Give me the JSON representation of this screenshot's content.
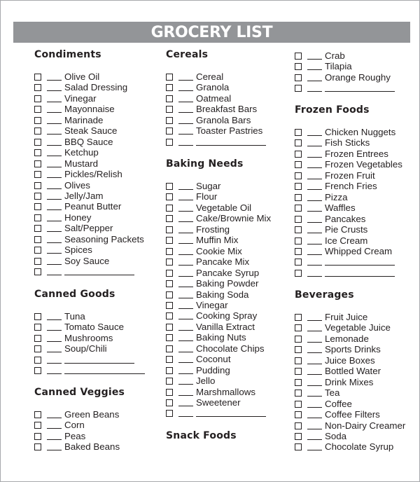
{
  "title": "GROCERY LIST",
  "colors": {
    "banner": "#939598",
    "text": "#231f20",
    "border": "#a7a9ac"
  },
  "columns": [
    {
      "sections": [
        {
          "heading": "Condiments",
          "items": [
            "Olive Oil",
            "Salad Dressing",
            "Vinegar",
            "Mayonnaise",
            "Marinade",
            "Steak Sauce",
            "BBQ Sauce",
            "Ketchup",
            "Mustard",
            "Pickles/Relish",
            "Olives",
            "Jelly/Jam",
            "Peanut Butter",
            "Honey",
            "Salt/Pepper",
            "Seasoning Packets",
            "Spices",
            "Soy Sauce",
            ""
          ]
        },
        {
          "heading": "Canned Goods",
          "items": [
            "Tuna",
            "Tomato Sauce",
            "Mushrooms",
            "Soup/Chili",
            "",
            ""
          ]
        },
        {
          "heading": "Canned Veggies",
          "items": [
            "Green Beans",
            "Corn",
            "Peas",
            "Baked Beans"
          ]
        }
      ]
    },
    {
      "sections": [
        {
          "heading": "Cereals",
          "items": [
            "Cereal",
            "Granola",
            "Oatmeal",
            "Breakfast Bars",
            "Granola Bars",
            "Toaster Pastries",
            ""
          ]
        },
        {
          "heading": "Baking Needs",
          "items": [
            "Sugar",
            "Flour",
            "Vegetable Oil",
            "Cake/Brownie Mix",
            "Frosting",
            "Muffin Mix",
            "Cookie Mix",
            "Pancake Mix",
            "Pancake Syrup",
            "Baking Powder",
            "Baking Soda",
            "Vinegar",
            "Cooking Spray",
            "Vanilla Extract",
            "Baking Nuts",
            "Chocolate Chips",
            "Coconut",
            "Pudding",
            "Jello",
            "Marshmallows",
            "Sweetener",
            ""
          ]
        },
        {
          "heading": "Snack Foods",
          "items": []
        }
      ]
    },
    {
      "sections": [
        {
          "heading": "",
          "items": [
            "Crab",
            "Tilapia",
            "Orange Roughy",
            ""
          ]
        },
        {
          "heading": "Frozen Foods",
          "items": [
            "Chicken Nuggets",
            "Fish Sticks",
            "Frozen Entrees",
            "Frozen Vegetables",
            "Frozen Fruit",
            "French Fries",
            "Pizza",
            "Waffles",
            "Pancakes",
            "Pie Crusts",
            "Ice Cream",
            "Whipped Cream",
            "",
            ""
          ]
        },
        {
          "heading": "Beverages",
          "items": [
            "Fruit Juice",
            "Vegetable Juice",
            "Lemonade",
            "Sports Drinks",
            "Juice Boxes",
            "Bottled Water",
            "Drink Mixes",
            "Tea",
            "Coffee",
            "Coffee Filters",
            "Non-Dairy Creamer",
            "Soda",
            "Chocolate Syrup"
          ]
        }
      ]
    }
  ]
}
